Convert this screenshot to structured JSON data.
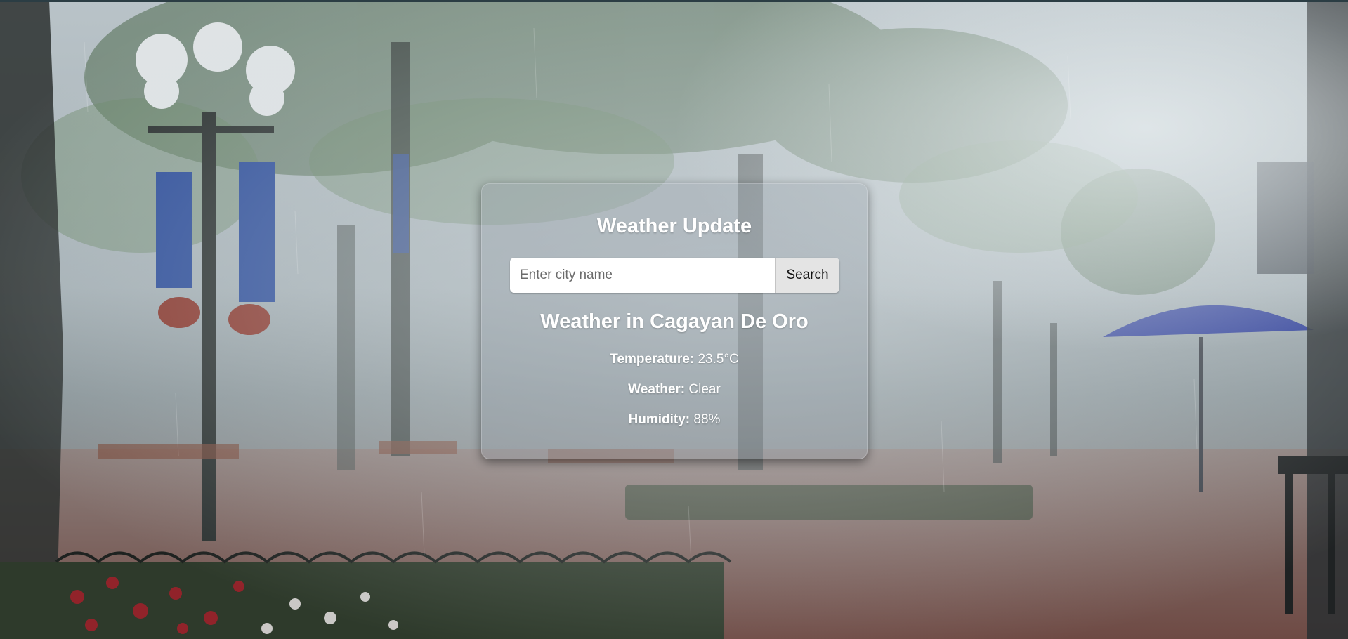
{
  "app": {
    "title": "Weather Update"
  },
  "search": {
    "placeholder": "Enter city name",
    "value": "",
    "button_label": "Search"
  },
  "result": {
    "heading": "Weather in Cagayan De Oro",
    "temperature": {
      "label": "Temperature:",
      "value": "23.5°C"
    },
    "weather": {
      "label": "Weather:",
      "value": "Clear"
    },
    "humidity": {
      "label": "Humidity:",
      "value": "88%"
    }
  },
  "background": {
    "scene": "rainy-park-photo"
  },
  "colors": {
    "text": "#ffffff",
    "card_tint": "#96a0a8",
    "button_bg": "#e4e4e4"
  }
}
